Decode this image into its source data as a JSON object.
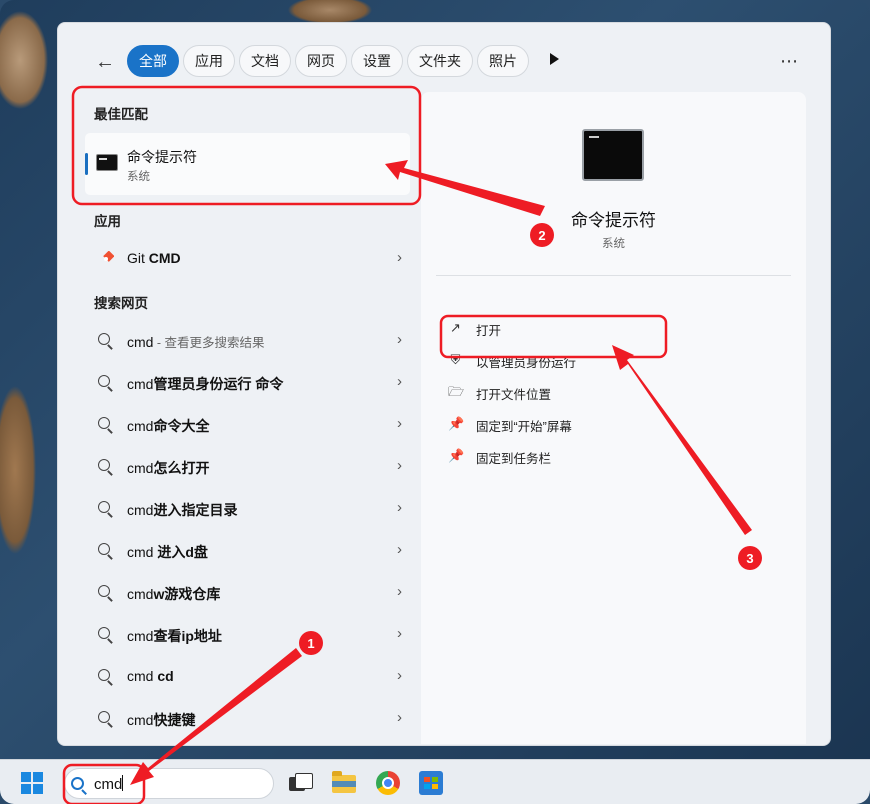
{
  "filter_tabs": [
    "全部",
    "应用",
    "文档",
    "网页",
    "设置",
    "文件夹",
    "照片"
  ],
  "active_tab_index": 0,
  "best_match": {
    "section_title": "最佳匹配",
    "name": "命令提示符",
    "subtitle": "系统"
  },
  "apps": {
    "section_title": "应用",
    "items": [
      {
        "label": "Git ",
        "bold": "CMD",
        "icon": "git-icon"
      }
    ]
  },
  "web": {
    "section_title": "搜索网页",
    "items": [
      {
        "plain": "cmd",
        "bold": "",
        "hint": " - 查看更多搜索结果"
      },
      {
        "plain": "cmd",
        "bold": "管理员身份运行 命令",
        "hint": ""
      },
      {
        "plain": "cmd",
        "bold": "命令大全",
        "hint": ""
      },
      {
        "plain": "cmd",
        "bold": "怎么打开",
        "hint": ""
      },
      {
        "plain": "cmd",
        "bold": "进入指定目录",
        "hint": ""
      },
      {
        "plain": "cmd ",
        "bold": "进入d盘",
        "hint": ""
      },
      {
        "plain": "cmd",
        "bold": "w游戏仓库",
        "hint": ""
      },
      {
        "plain": "cmd",
        "bold": "查看ip地址",
        "hint": ""
      },
      {
        "plain": "cmd ",
        "bold": "cd",
        "hint": ""
      },
      {
        "plain": "cmd",
        "bold": "快捷键",
        "hint": ""
      }
    ]
  },
  "detail": {
    "name": "命令提示符",
    "subtitle": "系统",
    "actions": [
      {
        "label": "打开",
        "icon": "open-external-icon"
      },
      {
        "label": "以管理员身份运行",
        "icon": "shield-icon"
      },
      {
        "label": "打开文件位置",
        "icon": "folder-icon"
      },
      {
        "label": "固定到“开始”屏幕",
        "icon": "pin-icon"
      },
      {
        "label": "固定到任务栏",
        "icon": "pin-icon"
      }
    ]
  },
  "taskbar": {
    "search_value": "cmd",
    "apps": [
      "task-view-icon",
      "file-explorer-icon",
      "chrome-icon",
      "store-icon"
    ]
  },
  "annotations": {
    "markers": [
      "1",
      "2",
      "3"
    ],
    "color": "#ee1c24"
  },
  "colors": {
    "accent": "#1a73c8",
    "annotation_red": "#ee1c24"
  }
}
